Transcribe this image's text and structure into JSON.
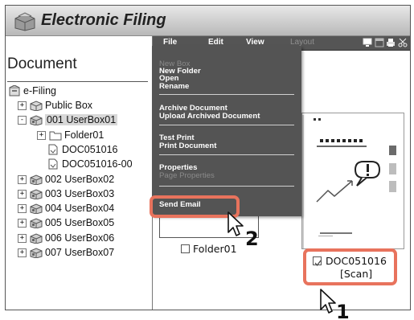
{
  "app": {
    "title": "Electronic Filing",
    "logo_icon": "folder-logo-icon"
  },
  "sidebar": {
    "heading": "Document",
    "tree": [
      {
        "label": "e-Filing",
        "icon": "cabinet-icon",
        "toggle": ""
      },
      {
        "label": "Public Box",
        "icon": "box-icon",
        "toggle": "+"
      },
      {
        "label": "001 UserBox01",
        "icon": "user-box-icon",
        "toggle": "-"
      },
      {
        "label": "Folder01",
        "icon": "folder-icon",
        "toggle": "+"
      },
      {
        "label": "DOC051016",
        "icon": "document-icon",
        "toggle": ""
      },
      {
        "label": "DOC051016-00",
        "icon": "document-icon",
        "toggle": ""
      },
      {
        "label": "002 UserBox02",
        "icon": "user-box-icon",
        "toggle": "+"
      },
      {
        "label": "003 UserBox03",
        "icon": "user-box-icon",
        "toggle": "+"
      },
      {
        "label": "004 UserBox04",
        "icon": "user-box-icon",
        "toggle": "+"
      },
      {
        "label": "005 UserBox05",
        "icon": "user-box-icon",
        "toggle": "+"
      },
      {
        "label": "006 UserBox06",
        "icon": "user-box-icon",
        "toggle": "+"
      },
      {
        "label": "007 UserBox07",
        "icon": "user-box-icon",
        "toggle": "+"
      }
    ]
  },
  "toolbar": {
    "menus": [
      "File",
      "Edit",
      "View",
      "Layout"
    ],
    "icons": [
      "monitor-icon",
      "window-icon",
      "print-icon",
      "scissors-icon"
    ]
  },
  "file_menu": {
    "items": [
      {
        "label": "New Box",
        "enabled": false
      },
      {
        "label": "New Folder",
        "enabled": true
      },
      {
        "label": "Open",
        "enabled": true
      },
      {
        "label": "Rename",
        "enabled": true
      },
      {
        "label": "Archive Document",
        "enabled": true
      },
      {
        "label": "Upload Archived Document",
        "enabled": true
      },
      {
        "label": "Test Print",
        "enabled": true
      },
      {
        "label": "Print Document",
        "enabled": true
      },
      {
        "label": "Properties",
        "enabled": true
      },
      {
        "label": "Page Properties",
        "enabled": false
      },
      {
        "label": "Send Email",
        "enabled": true
      }
    ]
  },
  "content": {
    "folder_label": "Folder01",
    "doc_label": "DOC051016",
    "doc_sublabel": "[Scan]",
    "doc_checked": true
  },
  "steps": {
    "first": "1",
    "second": "2"
  },
  "colors": {
    "highlight": "#e8735d",
    "menu_bg": "#545454",
    "toolbar_bg": "#555555"
  }
}
